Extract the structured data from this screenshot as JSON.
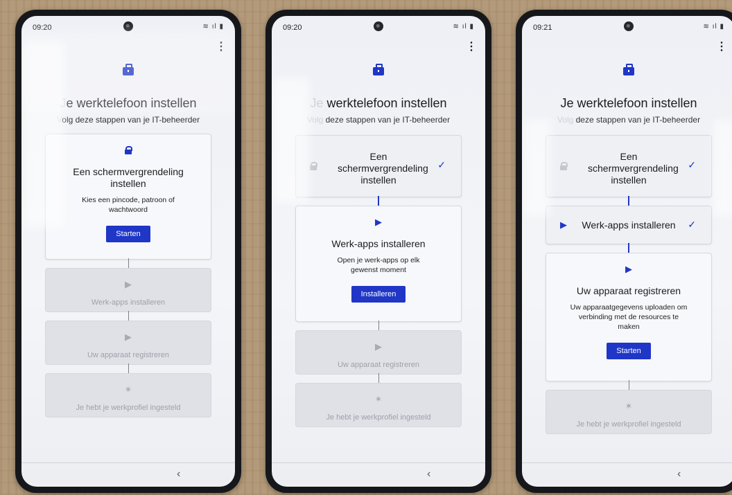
{
  "phones": [
    {
      "time": "09:20",
      "title_prefix": "J",
      "title_rest": "e werktelefoon instellen",
      "subtitle_prefix": "V",
      "subtitle_rest": "olg deze stappen van je IT-beheerder",
      "step1": {
        "title": "Een schermvergrendeling instellen",
        "desc": "Kies een pincode, patroon of wachtwoord",
        "button": "Starten"
      },
      "step2": {
        "title": "Werk-apps installeren"
      },
      "step3": {
        "title": "Uw apparaat registreren"
      },
      "step4": {
        "title": "Je hebt je werkprofiel ingesteld"
      }
    },
    {
      "time": "09:20",
      "title_prefix": "Je",
      "title_rest": " werktelefoon instellen",
      "subtitle_prefix": "Volg",
      "subtitle_rest": " deze stappen van je IT-beheerder",
      "step1": {
        "title": "Een schermvergrendeling instellen",
        "check": "✓"
      },
      "step2": {
        "title": "Werk-apps installeren",
        "desc": "Open je werk-apps op elk gewenst moment",
        "button": "Installeren"
      },
      "step3": {
        "title": "Uw apparaat registreren"
      },
      "step4": {
        "title": "Je hebt je werkprofiel ingesteld"
      }
    },
    {
      "time": "09:21",
      "title_prefix": "",
      "title_rest": "Je werktelefoon instellen",
      "subtitle_prefix": "Volg",
      "subtitle_rest": " deze stappen van je IT-beheerder",
      "step1": {
        "title": "Een schermvergrendeling instellen",
        "check": "✓"
      },
      "step2": {
        "title": "Werk-apps installeren",
        "check": "✓"
      },
      "step3": {
        "title": "Uw apparaat registreren",
        "desc": "Uw apparaatgegevens uploaden om verbinding met de resources te maken",
        "button": "Starten"
      },
      "step4": {
        "title": "Je hebt je werkprofiel ingesteld"
      }
    }
  ],
  "icons": {
    "status": "wifi-signal-battery-icons",
    "menu": "overflow-menu-icon",
    "briefcase": "briefcase-icon",
    "lock": "lock-icon",
    "play": "play-store-icon",
    "party": "party-popper-icon",
    "check": "checkmark-icon",
    "back": "back-chevron-icon"
  },
  "colors": {
    "accent": "#1f36c7",
    "disabled_card": "#dfe1e6",
    "disabled_text": "#9da1a9"
  }
}
